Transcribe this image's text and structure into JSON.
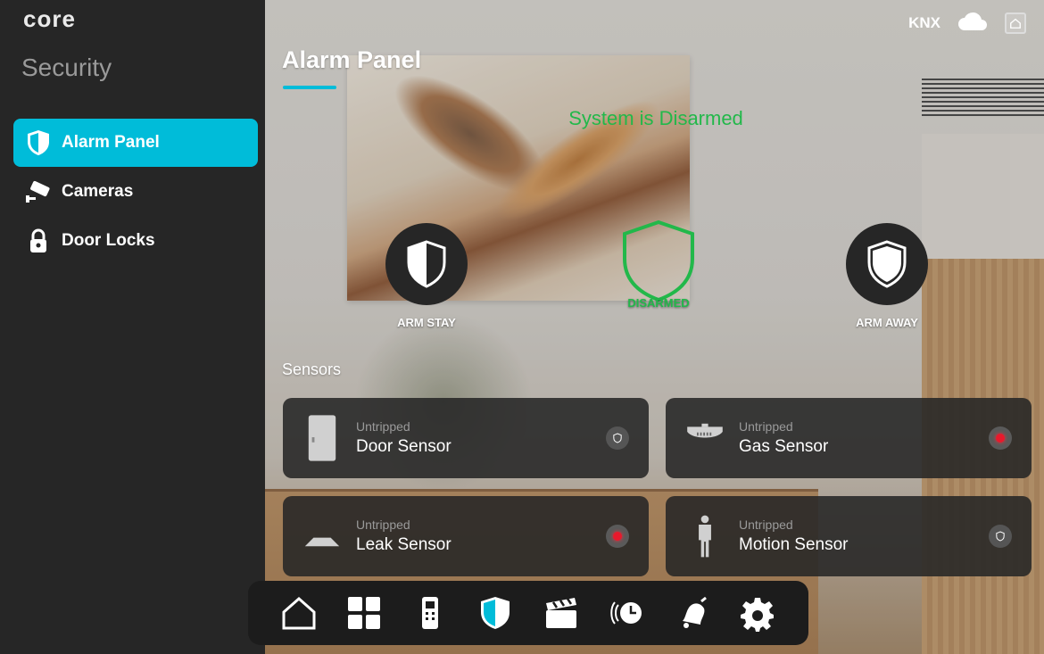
{
  "app": {
    "logo": "core"
  },
  "sidebar": {
    "section_title": "Security",
    "items": [
      {
        "label": "Alarm Panel",
        "icon": "shield-icon",
        "active": true
      },
      {
        "label": "Cameras",
        "icon": "camera-icon",
        "active": false
      },
      {
        "label": "Door Locks",
        "icon": "lock-icon",
        "active": false
      }
    ]
  },
  "topbar": {
    "protocol": "KNX",
    "cloud_icon": "cloud-icon",
    "home_icon": "home-icon"
  },
  "main": {
    "title": "Alarm Panel",
    "status": "System is Disarmed",
    "modes": [
      {
        "label": "ARM STAY",
        "icon": "half-shield-icon"
      },
      {
        "label": "DISARMED",
        "icon": "disarmed-shield-icon",
        "active": true
      },
      {
        "label": "ARM AWAY",
        "icon": "full-shield-icon"
      }
    ],
    "sensors_label": "Sensors",
    "sensors": [
      {
        "state": "Untripped",
        "name": "Door Sensor",
        "icon": "door-icon",
        "alarm": false
      },
      {
        "state": "Untripped",
        "name": "Gas Sensor",
        "icon": "gas-detector-icon",
        "alarm": true
      },
      {
        "state": "Untripped",
        "name": "Leak Sensor",
        "icon": "leak-sensor-icon",
        "alarm": true
      },
      {
        "state": "Untripped",
        "name": "Motion Sensor",
        "icon": "person-icon",
        "alarm": false
      }
    ]
  },
  "dock": {
    "items": [
      {
        "icon": "home-icon"
      },
      {
        "icon": "grid-icon"
      },
      {
        "icon": "intercom-icon"
      },
      {
        "icon": "shield-icon",
        "active": true
      },
      {
        "icon": "clapperboard-icon"
      },
      {
        "icon": "clock-signal-icon"
      },
      {
        "icon": "bell-icon"
      },
      {
        "icon": "gear-icon"
      }
    ]
  },
  "colors": {
    "accent": "#00bcd9",
    "disarmed": "#22b84a",
    "alarm": "#e8192c",
    "sidebar": "#262626"
  }
}
